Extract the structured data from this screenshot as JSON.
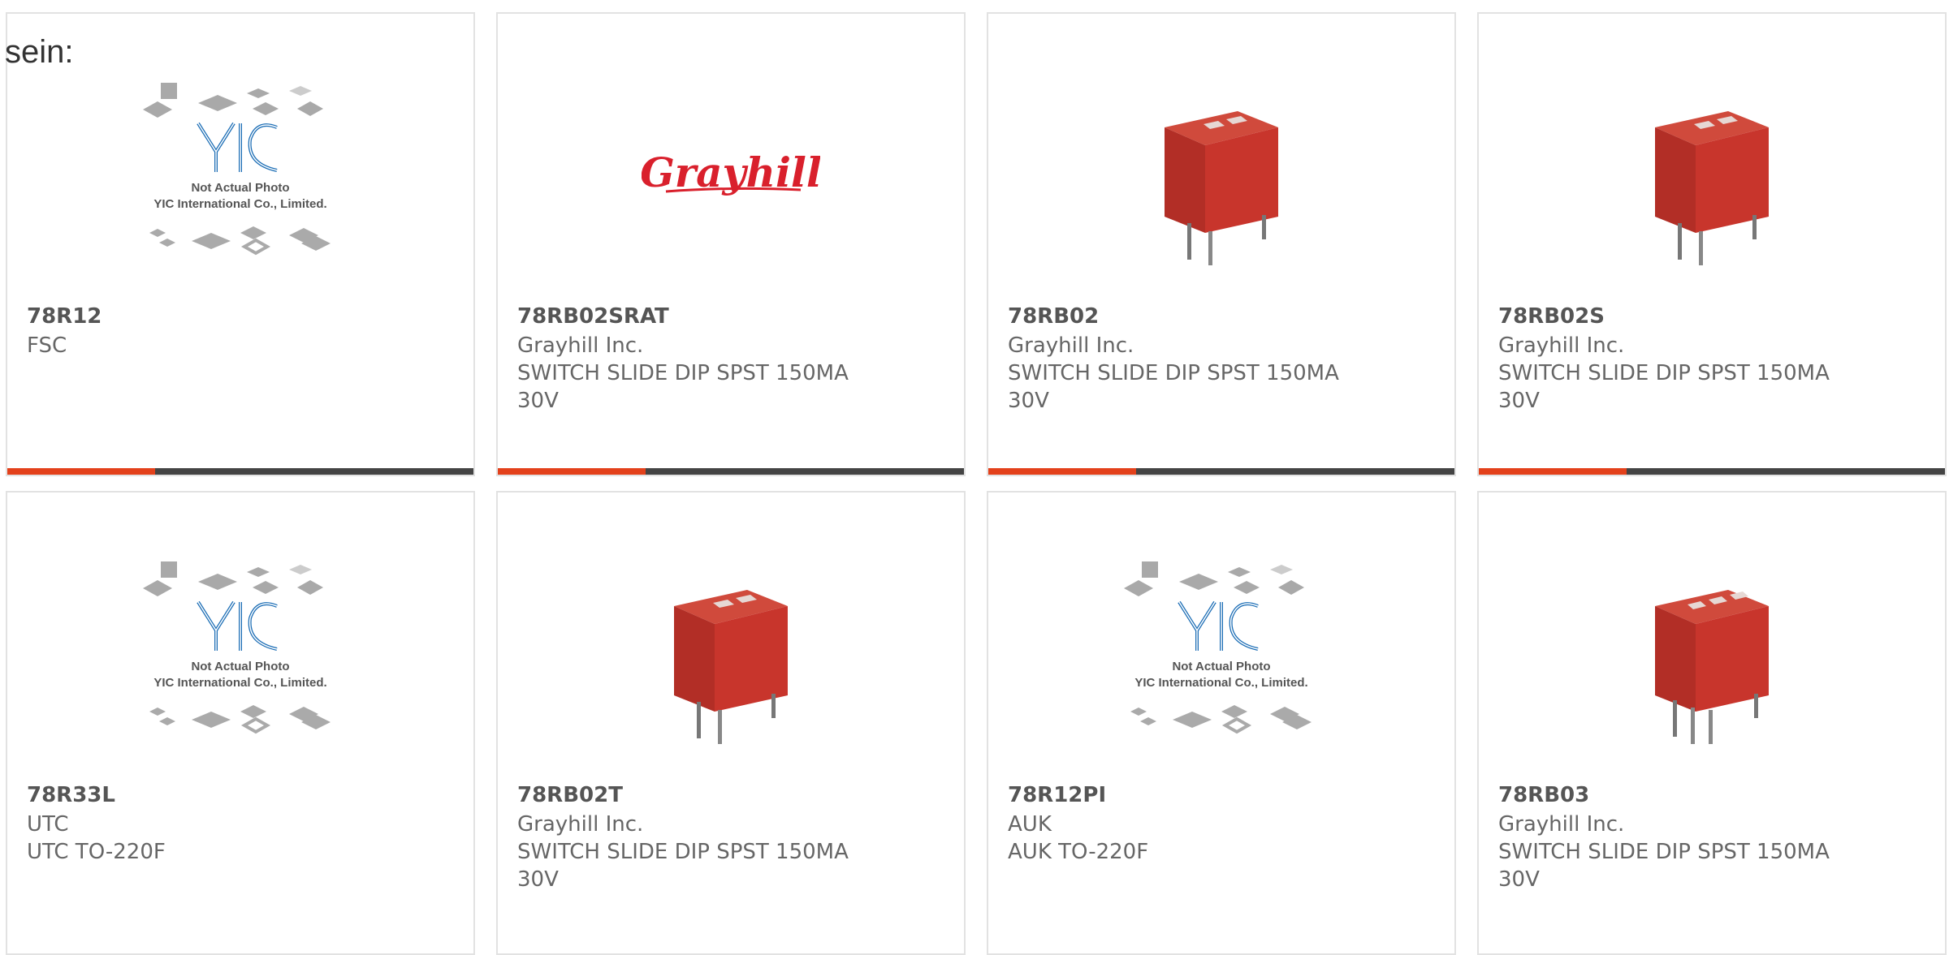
{
  "intro_text": "sein:",
  "products": [
    {
      "part": "78R12",
      "manufacturer": "FSC",
      "description": "",
      "image": "yic-placeholder",
      "placeholder_text": [
        "Not Actual Photo",
        "YIC International Co., Limited."
      ]
    },
    {
      "part": "78RB02SRAT",
      "manufacturer": "Grayhill Inc.",
      "description": "SWITCH SLIDE DIP SPST 150MA 30V",
      "image": "grayhill-logo",
      "logo_text": "Grayhill"
    },
    {
      "part": "78RB02",
      "manufacturer": "Grayhill Inc.",
      "description": "SWITCH SLIDE DIP SPST 150MA 30V",
      "image": "dip-switch-2"
    },
    {
      "part": "78RB02S",
      "manufacturer": "Grayhill Inc.",
      "description": "SWITCH SLIDE DIP SPST 150MA 30V",
      "image": "dip-switch-2"
    },
    {
      "part": "78R33L",
      "manufacturer": "UTC",
      "description": "UTC TO-220F",
      "image": "yic-placeholder",
      "placeholder_text": [
        "Not Actual Photo",
        "YIC International Co., Limited."
      ]
    },
    {
      "part": "78RB02T",
      "manufacturer": "Grayhill Inc.",
      "description": "SWITCH SLIDE DIP SPST 150MA 30V",
      "image": "dip-switch-2"
    },
    {
      "part": "78R12PI",
      "manufacturer": "AUK",
      "description": "AUK TO-220F",
      "image": "yic-placeholder",
      "placeholder_text": [
        "Not Actual Photo",
        "YIC International Co., Limited."
      ]
    },
    {
      "part": "78RB03",
      "manufacturer": "Grayhill Inc.",
      "description": "SWITCH SLIDE DIP SPST 150MA 30V",
      "image": "dip-switch-3"
    }
  ],
  "colors": {
    "accent": "#e3411b",
    "bar": "#444444",
    "switch_red": "#c8352c",
    "logo_red": "#d9202c",
    "yic_blue": "#1b6db5"
  }
}
